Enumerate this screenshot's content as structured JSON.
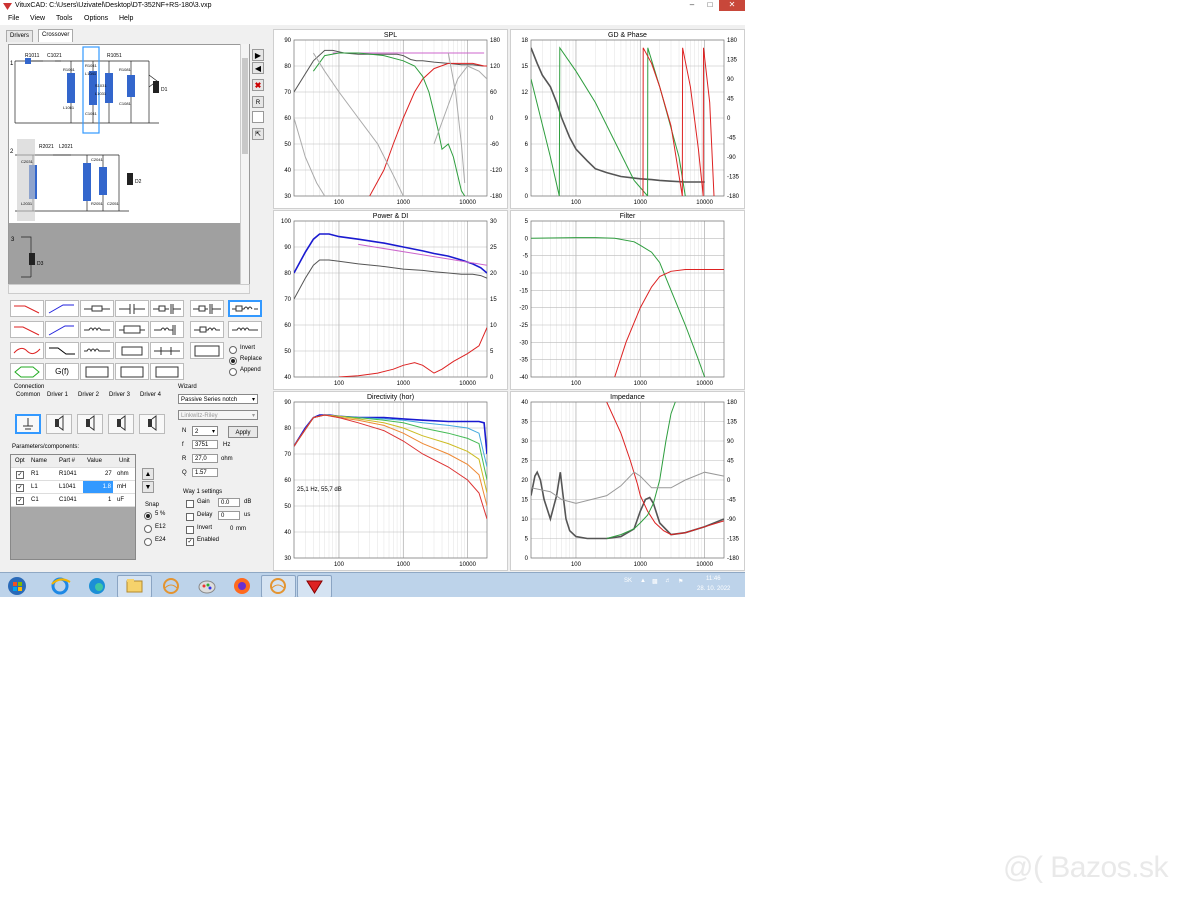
{
  "window": {
    "title": "VituxCAD: C:\\Users\\Uzivatel\\Desktop\\DT-352NF+RS-180\\3.vxp",
    "menu": [
      "File",
      "View",
      "Tools",
      "Options",
      "Help"
    ]
  },
  "tabs": [
    {
      "label": "Drivers"
    },
    {
      "label": "Crossover"
    }
  ],
  "schematic": {
    "way1_number": "1",
    "way2_number": "2",
    "way3_number": "3",
    "labels": [
      "R1011",
      "C1021",
      "R1041",
      "L1041",
      "C1041",
      "R1051",
      "R1061",
      "L1061",
      "R1081",
      "C1081",
      "S1031",
      "L1031",
      "D1",
      "R2021",
      "L2021",
      "C2031",
      "L2031",
      "C2041",
      "R2051",
      "C2051",
      "D2",
      "D3"
    ]
  },
  "palette": {
    "options": [
      "Invert",
      "Replace",
      "Append"
    ],
    "selected": "Replace",
    "gf_label": "G(f)"
  },
  "connection": {
    "title": "Connection",
    "items": [
      "Common",
      "Driver 1",
      "Driver 2",
      "Driver 3",
      "Driver 4"
    ]
  },
  "wizard": {
    "title": "Wizard",
    "type": "Passive Series notch",
    "alignment": "Linkwitz-Riley",
    "n_label": "N",
    "n_value": "2",
    "apply_label": "Apply",
    "f_label": "f",
    "f_value": "3751",
    "f_unit": "Hz",
    "r_label": "R",
    "r_value": "27,0",
    "r_unit": "ohm",
    "q_label": "Q",
    "q_value": "1.57"
  },
  "parameters": {
    "title": "Parameters/components:",
    "columns": [
      "Opt",
      "Name",
      "Part #",
      "Value",
      "Unit"
    ],
    "rows": [
      {
        "name": "R1",
        "part": "R1041",
        "value": "27",
        "unit": "ohm"
      },
      {
        "name": "L1",
        "part": "L1041",
        "value": "1.8",
        "unit": "mH"
      },
      {
        "name": "C1",
        "part": "C1041",
        "value": "1",
        "unit": "uF"
      }
    ]
  },
  "snap": {
    "title": "Snap",
    "options": [
      "5 %",
      "E12",
      "E24"
    ],
    "selected": "5 %"
  },
  "way_settings": {
    "title": "Way 1 settings",
    "gain_label": "Gain",
    "gain_value": "0.0",
    "gain_unit": "dB",
    "delay_label": "Delay",
    "delay_value": "0",
    "delay_unit": "us",
    "invert_label": "Invert",
    "invert_value": "0",
    "invert_unit": "mm",
    "enabled_label": "Enabled"
  },
  "chart_data": [
    {
      "type": "line",
      "title": "SPL",
      "x_scale": "log",
      "x_ticks": [
        "100",
        "1000",
        "10000"
      ],
      "ylim": [
        30,
        90
      ],
      "y_ticks": [
        "90",
        "80",
        "70",
        "60",
        "50",
        "40",
        "30"
      ],
      "y2_ticks": [
        "180",
        "120",
        "60",
        "0",
        "-60",
        "-120",
        "-180"
      ],
      "series": [
        {
          "color": "#555555",
          "x": [
            20,
            40,
            60,
            80,
            120,
            200,
            300,
            500,
            800,
            1000,
            1300,
            1600,
            2000,
            3000,
            5000,
            8000,
            12000,
            17000,
            20000
          ],
          "y": [
            70,
            82,
            86,
            86,
            85,
            84.5,
            84.5,
            84.5,
            84.5,
            84,
            82.5,
            82,
            82,
            81.5,
            81,
            80.5,
            80.5,
            80,
            80
          ]
        },
        {
          "color": "#cc66cc",
          "x": [
            80,
            18000
          ],
          "y": [
            85,
            85
          ]
        },
        {
          "color": "#dd2222",
          "x": [
            300,
            500,
            700,
            1000,
            1500,
            2000,
            3000,
            5000,
            8000,
            12000,
            18000,
            20000
          ],
          "y": [
            30,
            40,
            50,
            60,
            70,
            75,
            79,
            81,
            81,
            81,
            80,
            80
          ]
        },
        {
          "color": "#2e9e3e",
          "x": [
            40,
            60,
            100,
            200,
            500,
            1000,
            1500,
            2000,
            2500,
            3000,
            3500,
            4000,
            5000,
            6000,
            7000,
            8000,
            9000
          ],
          "y": [
            78,
            84,
            85,
            85,
            84,
            82,
            80,
            76,
            70,
            62,
            55,
            48,
            50,
            45,
            38,
            32,
            30
          ]
        },
        {
          "color": "#aaaaaa",
          "x": [
            40,
            60,
            100,
            200,
            400,
            700,
            1000
          ],
          "y": [
            85,
            78,
            70,
            60,
            50,
            38,
            30
          ]
        },
        {
          "color": "#aaaaaa",
          "x": [
            20,
            30,
            45,
            60
          ],
          "y": [
            60,
            45,
            35,
            30
          ]
        },
        {
          "color": "#aaaaaa",
          "x": [
            3000,
            5000,
            7000,
            10000,
            15000,
            20000
          ],
          "y": [
            50,
            65,
            75,
            80,
            78,
            75
          ]
        },
        {
          "color": "#aaaaaa",
          "x": [
            5000,
            6500,
            8000,
            9000
          ],
          "y": [
            85,
            70,
            50,
            35
          ]
        }
      ]
    },
    {
      "type": "line",
      "title": "GD & Phase",
      "x_scale": "log",
      "x_ticks": [
        "100",
        "1000",
        "10000"
      ],
      "ylim": [
        0,
        20
      ],
      "y_ticks": [
        "18",
        "15",
        "12",
        "9",
        "6",
        "3",
        "0"
      ],
      "y2_ticks": [
        "180",
        "135",
        "90",
        "45",
        "0",
        "-45",
        "-90",
        "-135",
        "-180"
      ],
      "series": [
        {
          "color": "#555555",
          "x": [
            20,
            25,
            30,
            40,
            50,
            60,
            80,
            100,
            150,
            200,
            300,
            500,
            800,
            1000,
            1500,
            2000,
            3000,
            5000,
            10000
          ],
          "y": [
            19,
            17,
            15.5,
            14,
            12,
            10,
            7.5,
            6,
            4.5,
            3.5,
            3,
            2.5,
            2.3,
            2.2,
            2.1,
            2.0,
            1.9,
            1.8,
            1.8
          ]
        },
        {
          "color": "#2e9e3e",
          "x": [
            20,
            40,
            55,
            56,
            100,
            200,
            400,
            800,
            1300,
            1310,
            2000,
            4000,
            5000
          ],
          "y": [
            15,
            5,
            0,
            19,
            16,
            12,
            7,
            2,
            0,
            19,
            14,
            5,
            0
          ]
        },
        {
          "color": "#dd2222",
          "x": [
            1100,
            1110,
            1500,
            2000,
            3000,
            4500,
            4550,
            6000,
            8000,
            9500,
            9600,
            12000,
            14000
          ],
          "y": [
            0,
            19,
            17,
            14,
            9,
            0,
            19,
            14,
            6,
            0,
            19,
            12,
            0
          ]
        }
      ]
    },
    {
      "type": "line",
      "title": "Power & DI",
      "x_scale": "log",
      "x_ticks": [
        "100",
        "1000",
        "10000"
      ],
      "ylim": [
        40,
        100
      ],
      "y_ticks": [
        "100",
        "90",
        "80",
        "70",
        "60",
        "50",
        "40"
      ],
      "y2_ticks": [
        "30",
        "25",
        "20",
        "15",
        "10",
        "5",
        "0"
      ],
      "series": [
        {
          "color": "#1a1ad0",
          "x": [
            20,
            30,
            40,
            50,
            70,
            100,
            200,
            500,
            1000,
            2000,
            3000,
            5000,
            8000,
            12000,
            16000,
            20000
          ],
          "y": [
            80,
            88,
            93,
            95,
            95,
            94,
            93,
            91.5,
            90,
            88.5,
            87.5,
            86.5,
            85,
            83.5,
            82,
            80
          ]
        },
        {
          "color": "#555555",
          "x": [
            20,
            30,
            40,
            50,
            70,
            100,
            200,
            500,
            1000,
            2000,
            3000,
            5000,
            8000,
            12000,
            16000,
            20000
          ],
          "y": [
            70,
            78,
            83,
            85,
            85,
            84.5,
            83.5,
            82.5,
            81.5,
            81,
            80.5,
            80,
            79.5,
            79.5,
            79,
            78
          ]
        },
        {
          "color": "#cc66cc",
          "x": [
            200,
            20000
          ],
          "y": [
            91,
            83
          ]
        },
        {
          "color": "#dd2222",
          "x": [
            100,
            200,
            400,
            700,
            1000,
            1500,
            2000,
            3000,
            4000,
            6000,
            10000,
            15000,
            20000
          ],
          "y": [
            40,
            40.5,
            41.5,
            43,
            44.5,
            45.5,
            44.5,
            41.5,
            43,
            46,
            49,
            52,
            59
          ]
        }
      ]
    },
    {
      "type": "line",
      "title": "Filter",
      "x_scale": "log",
      "x_ticks": [
        "100",
        "1000",
        "10000"
      ],
      "ylim": [
        -40,
        5
      ],
      "y_ticks": [
        "5",
        "0",
        "-5",
        "-10",
        "-15",
        "-20",
        "-25",
        "-30",
        "-35",
        "-40"
      ],
      "series": [
        {
          "color": "#2e9e3e",
          "x": [
            20,
            100,
            200,
            400,
            800,
            1000,
            1500,
            2000,
            3000,
            5000,
            8000,
            10000
          ],
          "y": [
            0,
            0.2,
            0.2,
            0,
            -1,
            -2,
            -4,
            -7,
            -15,
            -25,
            -35,
            -40
          ]
        },
        {
          "color": "#dd2222",
          "x": [
            400,
            600,
            1000,
            1500,
            2000,
            3000,
            5000,
            10000,
            20000
          ],
          "y": [
            -40,
            -30,
            -20,
            -14,
            -11,
            -9.5,
            -9,
            -9,
            -9
          ]
        }
      ]
    },
    {
      "type": "line",
      "title": "Directivity (hor)",
      "x_scale": "log",
      "x_ticks": [
        "100",
        "1000",
        "10000"
      ],
      "ylim": [
        30,
        90
      ],
      "y_ticks": [
        "90",
        "80",
        "70",
        "60",
        "50",
        "40",
        "30"
      ],
      "annotation": "25,1 Hz, 55,7 dB",
      "series": [
        {
          "color": "#1a1ad0",
          "x": [
            20,
            30,
            40,
            50,
            70,
            100,
            200,
            500,
            1000,
            2000,
            5000,
            10000,
            15000,
            18000,
            20000
          ],
          "y": [
            73,
            80,
            84,
            85,
            85,
            84.5,
            84,
            84,
            83.5,
            83,
            82.5,
            82.5,
            82.5,
            82,
            70
          ]
        },
        {
          "color": "#44aadd",
          "x": [
            20,
            40,
            60,
            100,
            200,
            500,
            1000,
            2000,
            5000,
            10000,
            15000,
            20000
          ],
          "y": [
            73,
            84,
            85,
            84.5,
            84,
            83.5,
            83,
            82,
            81,
            80,
            78,
            65
          ]
        },
        {
          "color": "#44bb55",
          "x": [
            20,
            40,
            60,
            100,
            200,
            500,
            1000,
            2000,
            5000,
            10000,
            15000,
            20000
          ],
          "y": [
            73,
            84,
            85,
            84.5,
            84,
            83,
            82,
            80,
            78,
            76,
            74,
            60
          ]
        },
        {
          "color": "#ccbb22",
          "x": [
            20,
            40,
            60,
            100,
            200,
            500,
            1000,
            2000,
            5000,
            10000,
            15000,
            20000
          ],
          "y": [
            73,
            84,
            85,
            84.5,
            83.5,
            82,
            80,
            77,
            74,
            71,
            68,
            55
          ]
        },
        {
          "color": "#ee8833",
          "x": [
            20,
            40,
            60,
            100,
            200,
            500,
            1000,
            2000,
            5000,
            10000,
            15000,
            20000
          ],
          "y": [
            73,
            84,
            85,
            84,
            83,
            81,
            78,
            74,
            70,
            66,
            62,
            50
          ]
        },
        {
          "color": "#dd3333",
          "x": [
            20,
            40,
            60,
            100,
            200,
            500,
            1000,
            2000,
            5000,
            10000,
            15000,
            20000
          ],
          "y": [
            73,
            84,
            85,
            84,
            82,
            79,
            75,
            70,
            65,
            60,
            55,
            45
          ]
        }
      ]
    },
    {
      "type": "line",
      "title": "Impedance",
      "x_scale": "log",
      "x_ticks": [
        "100",
        "1000",
        "10000"
      ],
      "ylim": [
        0,
        40
      ],
      "y_ticks": [
        "40",
        "35",
        "30",
        "25",
        "20",
        "15",
        "10",
        "5",
        "0"
      ],
      "y2_ticks": [
        "180",
        "135",
        "90",
        "45",
        "0",
        "-45",
        "-90",
        "-135",
        "-180"
      ],
      "series": [
        {
          "color": "#555555",
          "x": [
            20,
            23,
            25,
            28,
            32,
            40,
            50,
            57,
            62,
            70,
            80,
            100,
            150,
            300,
            500,
            800,
            1000,
            1200,
            1400,
            1600,
            2000,
            3000,
            5000,
            10000,
            20000
          ],
          "y": [
            16,
            21,
            22,
            20,
            15,
            10,
            16,
            22,
            17,
            10,
            7,
            5.5,
            5,
            5,
            5.5,
            7.5,
            12,
            15,
            15.5,
            14,
            9,
            6,
            6.5,
            8,
            10
          ]
        },
        {
          "color": "#dd2222",
          "x": [
            300,
            500,
            700,
            900,
            1000,
            1300,
            1700,
            2300,
            3000,
            5000,
            10000,
            20000
          ],
          "y": [
            40,
            32,
            25,
            19,
            16,
            12,
            9,
            7,
            6,
            6.5,
            8,
            9.5
          ]
        },
        {
          "color": "#2e9e3e",
          "x": [
            300,
            500,
            800,
            1000,
            1300,
            1600,
            2000,
            2500,
            3000,
            3500
          ],
          "y": [
            5,
            6,
            7.5,
            9,
            11,
            14,
            20,
            30,
            37,
            40
          ]
        },
        {
          "color": "#999999",
          "x": [
            20,
            40,
            60,
            100,
            300,
            500,
            800,
            1000,
            1500,
            3000,
            5000,
            10000,
            20000
          ],
          "y": [
            18,
            17,
            15,
            14,
            16,
            18.5,
            22,
            21,
            18,
            18,
            20,
            22,
            21
          ]
        }
      ]
    }
  ],
  "taskbar": {
    "lang": "SK",
    "time": "11:46",
    "date": "28. 10. 2022"
  },
  "watermark": {
    "text": "@( Bazos.sk"
  },
  "colors": {
    "blue": "#1a1ad0",
    "red": "#dd2222",
    "green": "#2e9e3e",
    "gray": "#555555",
    "magenta": "#cc66cc",
    "selection": "#3399ff"
  }
}
